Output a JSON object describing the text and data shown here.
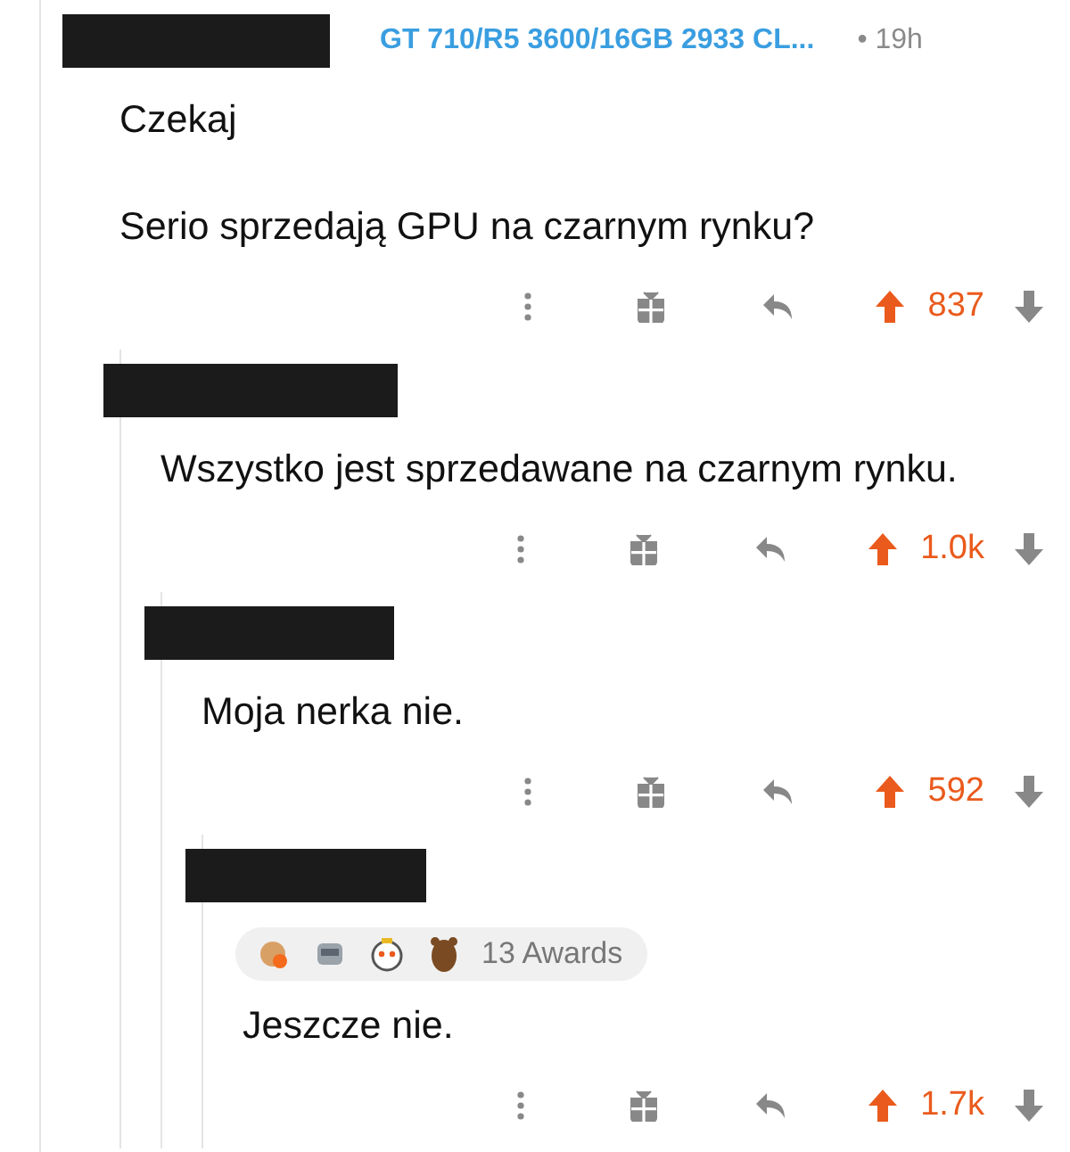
{
  "comments": [
    {
      "flair": "GT 710/R5 3600/16GB 2933 CL...",
      "time": "• 19h",
      "body": [
        "Czekaj",
        "Serio sprzedają GPU na czarnym rynku?"
      ],
      "score": "837",
      "upvoted": true,
      "children": [
        {
          "body": [
            "Wszystko jest sprzedawane na czarnym rynku."
          ],
          "score": "1.0k",
          "upvoted": true,
          "children": [
            {
              "body": [
                "Moja nerka nie."
              ],
              "score": "592",
              "upvoted": true,
              "children": [
                {
                  "awards": "13 Awards",
                  "body": [
                    "Jeszcze nie."
                  ],
                  "score": "1.7k",
                  "upvoted": true
                }
              ]
            }
          ]
        }
      ]
    }
  ]
}
